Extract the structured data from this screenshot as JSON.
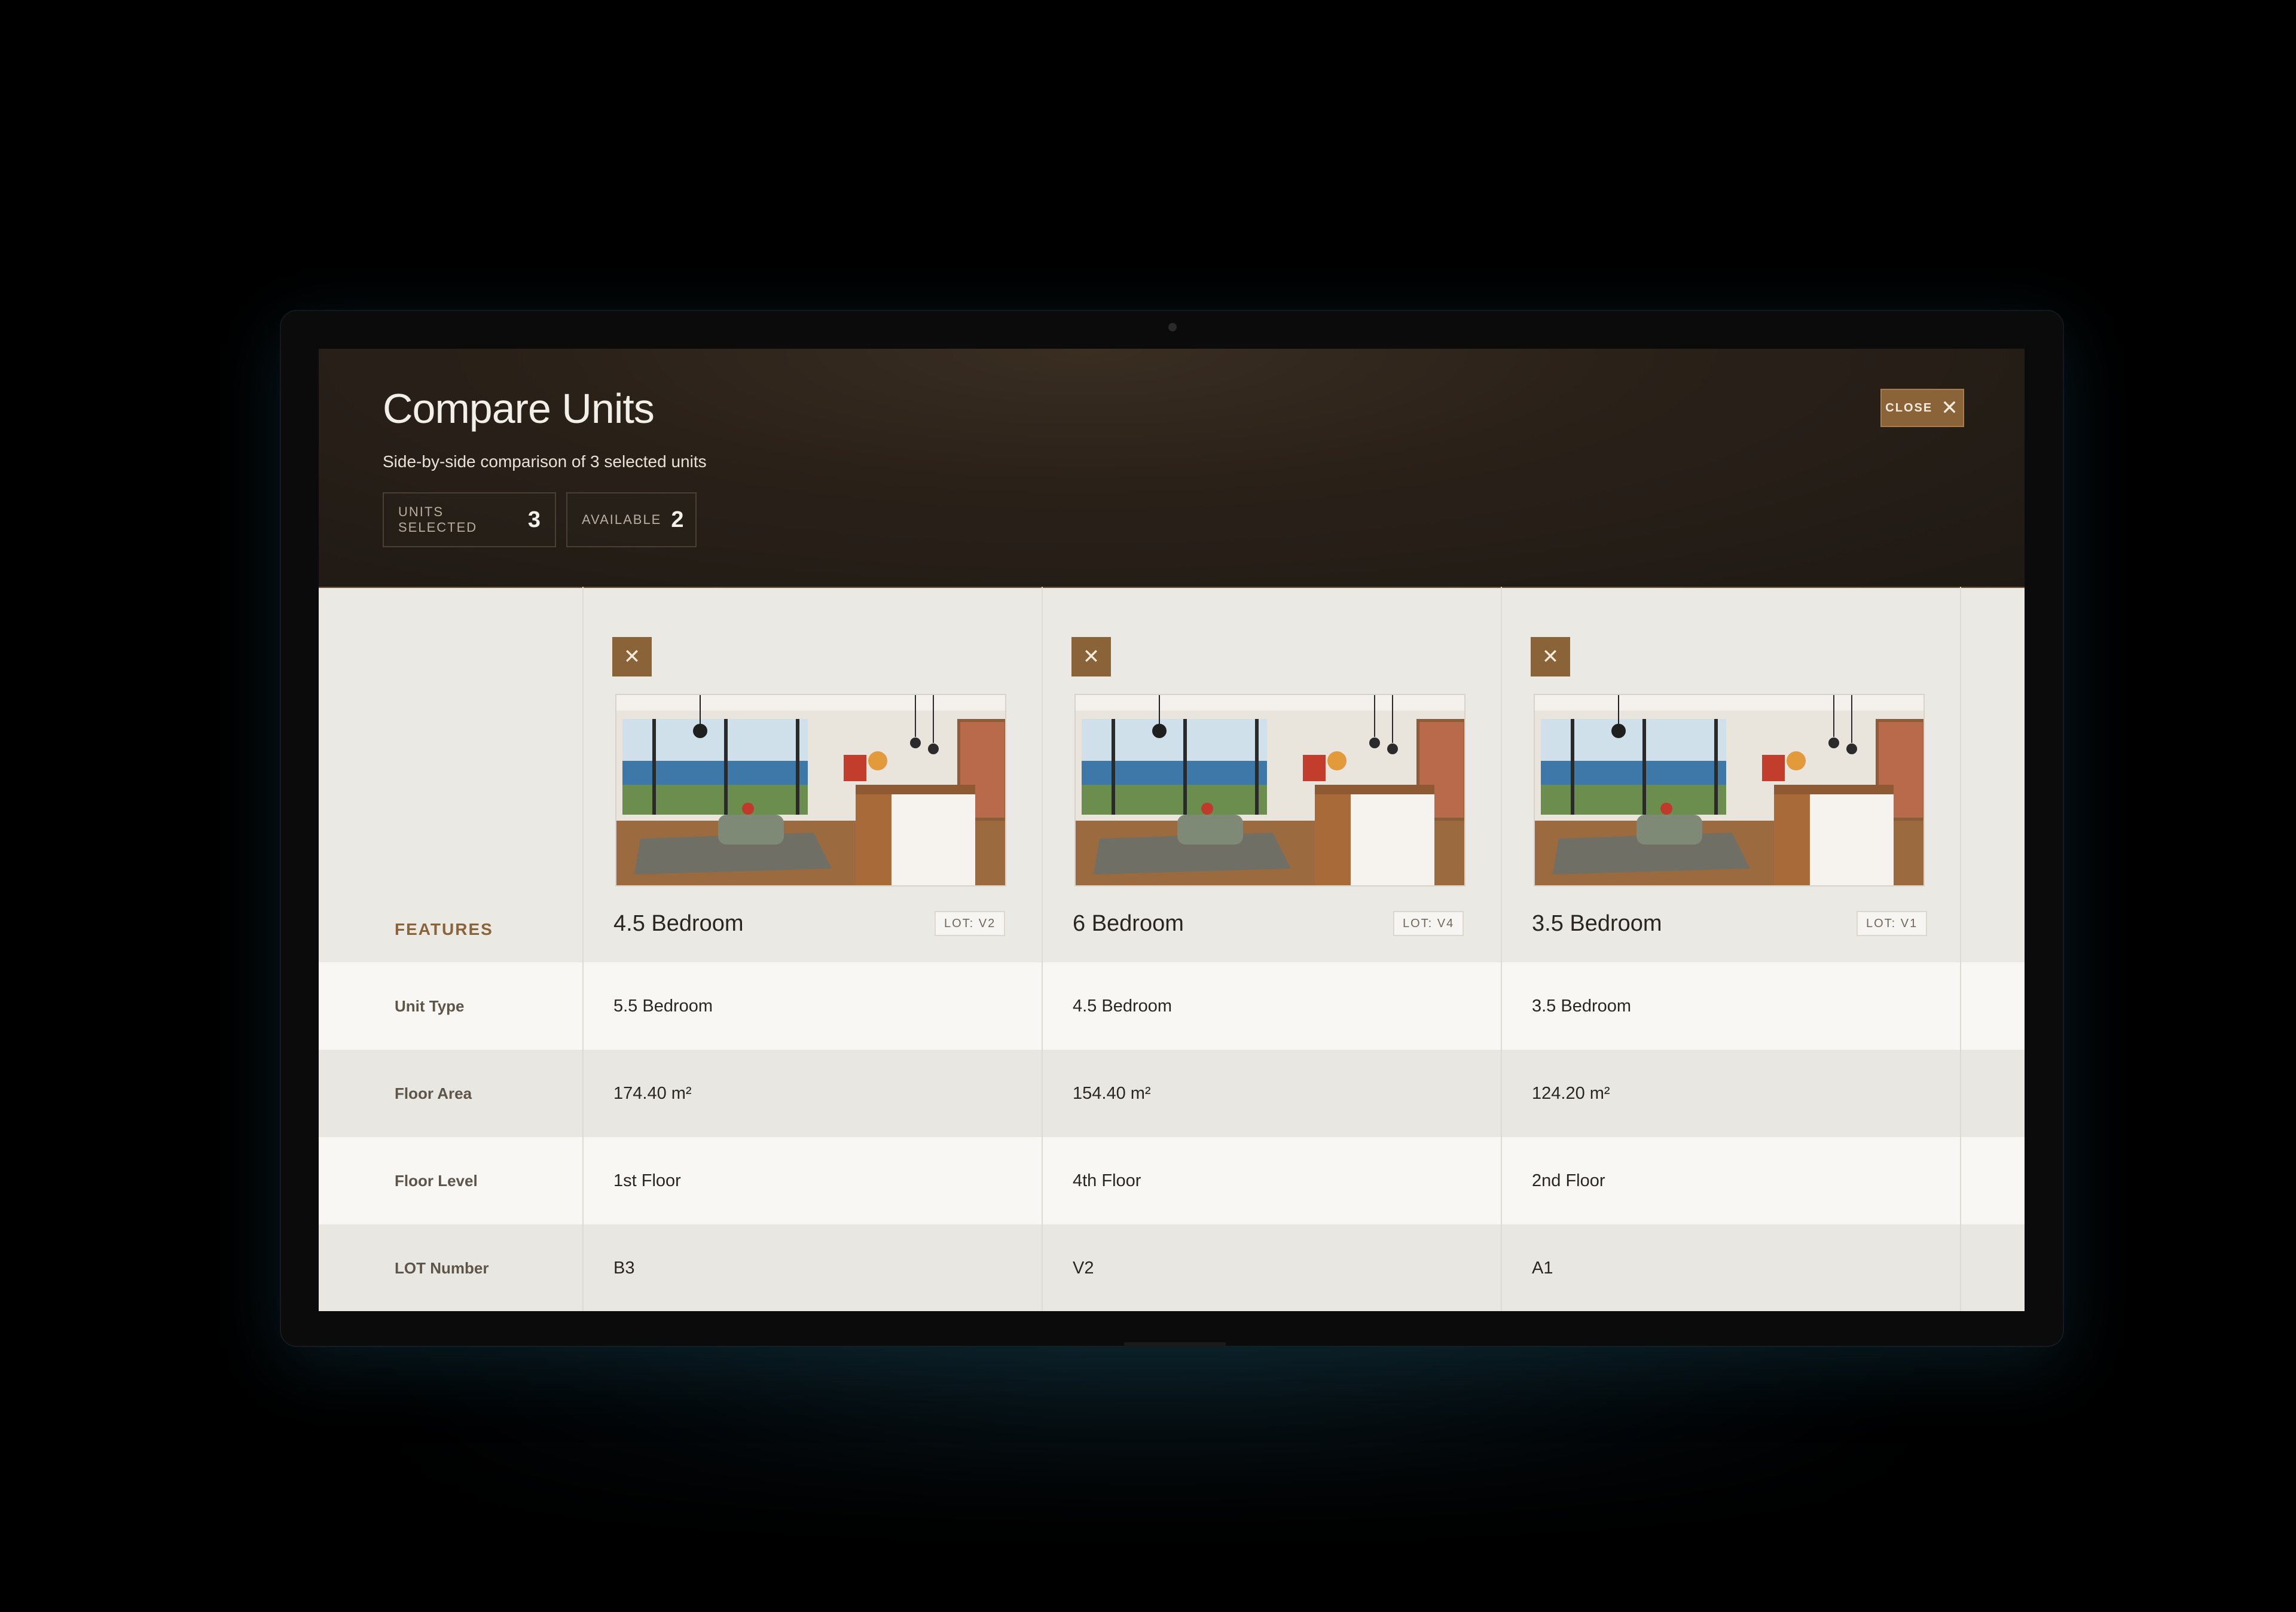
{
  "header": {
    "title": "Compare Units",
    "subtitle": "Side-by-side comparison of 3 selected units",
    "chips": [
      {
        "label": "UNITS SELECTED",
        "value": "3"
      },
      {
        "label": "AVAILABLE",
        "value": "2"
      }
    ],
    "close_label": "CLOSE",
    "close_icon": "✕"
  },
  "features_heading": "FEATURES",
  "remove_icon": "✕",
  "units": [
    {
      "name": "4.5 Bedroom",
      "lot": "LOT: V2"
    },
    {
      "name": "6 Bedroom",
      "lot": "LOT: V4"
    },
    {
      "name": "3.5 Bedroom",
      "lot": "LOT: V1"
    }
  ],
  "rows": [
    {
      "label": "Unit Type",
      "values": [
        "5.5 Bedroom",
        "4.5 Bedroom",
        "3.5 Bedroom"
      ]
    },
    {
      "label": "Floor Area",
      "values": [
        "174.40 m²",
        "154.40 m²",
        "124.20 m²"
      ]
    },
    {
      "label": "Floor Level",
      "values": [
        "1st Floor",
        "4th Floor",
        "2nd Floor"
      ]
    },
    {
      "label": "LOT Number",
      "values": [
        "B3",
        "V2",
        "A1"
      ]
    }
  ],
  "colors": {
    "accent": "#8a6338",
    "header_bg": "#231c16",
    "row_light": "#f8f7f4",
    "row_dark": "#e9e7e2"
  }
}
